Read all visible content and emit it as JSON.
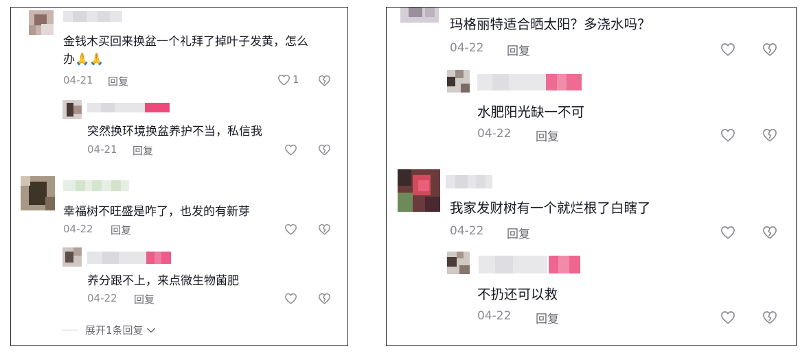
{
  "left": {
    "c1": {
      "text_line1": "金钱木买回来换盆一个礼拜了掉叶子发黄，怎么",
      "text_line2": "办",
      "emoji": "🙏🙏",
      "date": "04-21",
      "reply": "回复",
      "like_count": "1"
    },
    "c1r1": {
      "text": "突然换环境换盆养护不当，私信我",
      "date": "04-21",
      "reply": "回复"
    },
    "c2": {
      "text": "幸福树不旺盛是咋了，也发的有新芽",
      "date": "04-22",
      "reply": "回复"
    },
    "c2r1": {
      "text": "养分跟不上，来点微生物菌肥",
      "date": "04-22",
      "reply": "回复"
    },
    "expand": "展开1条回复"
  },
  "right": {
    "c1": {
      "text": "玛格丽特适合晒太阳？多浇水吗？",
      "date": "04-22",
      "reply": "回复"
    },
    "c1r1": {
      "text": "水肥阳光缺一不可",
      "date": "04-22",
      "reply": "回复"
    },
    "c2": {
      "text": "我家发财树有一个就烂根了白瞎了",
      "date": "04-22",
      "reply": "回复"
    },
    "c2r1": {
      "text": "不扔还可以救",
      "date": "04-22",
      "reply": "回复"
    }
  },
  "colors": {
    "text": "#161823",
    "meta": "#8a8b91",
    "border": "#2a2a2a",
    "author_badge": "#ee4d7e"
  },
  "icons": {
    "like": "heart-outline-icon",
    "dislike": "broken-heart-icon",
    "expand": "chevron-down-icon"
  }
}
